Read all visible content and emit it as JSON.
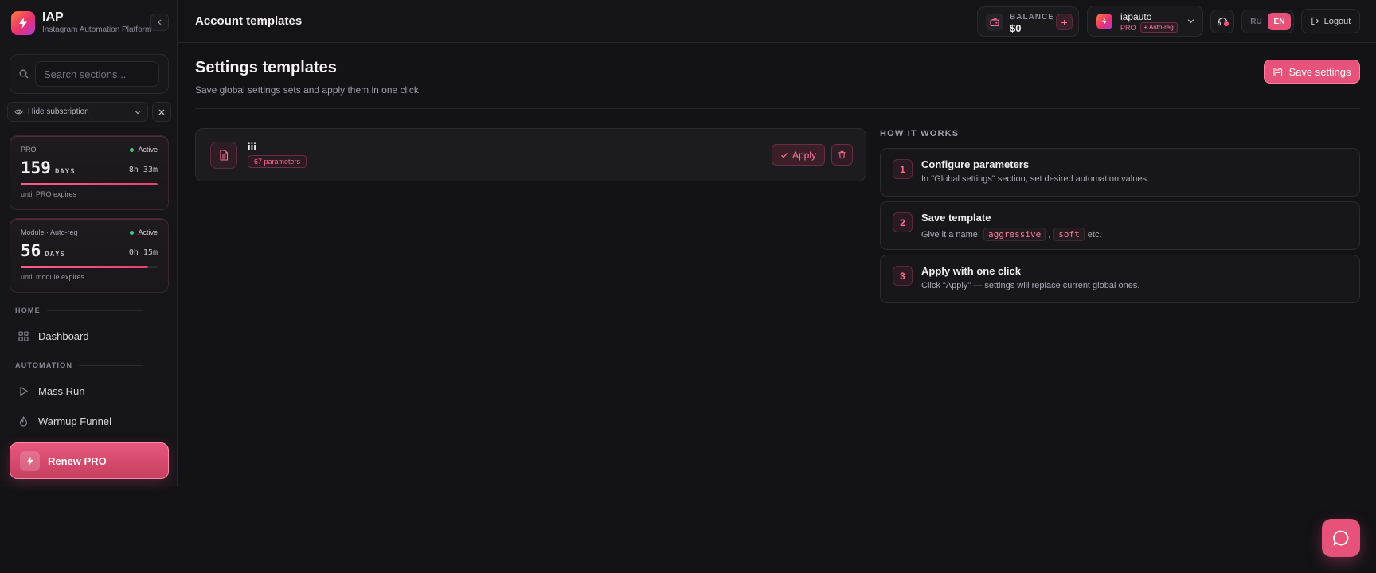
{
  "brand": {
    "title": "IAP",
    "subtitle": "Instagram Automation Platform"
  },
  "sidebar": {
    "search_placeholder": "Search sections...",
    "hide_subscription_label": "Hide subscription",
    "subscriptions": [
      {
        "kind": "PRO",
        "status": "Active",
        "days": "159",
        "days_unit": "DAYS",
        "time": "8h 33m",
        "until": "until PRO expires",
        "progress": 1.0
      },
      {
        "kind": "Module · Auto-reg",
        "status": "Active",
        "days": "56",
        "days_unit": "DAYS",
        "time": "0h 15m",
        "until": "until module expires",
        "progress": 0.93
      }
    ],
    "sections": {
      "home": "HOME",
      "automation": "AUTOMATION"
    },
    "nav": {
      "dashboard": "Dashboard",
      "mass_run": "Mass Run",
      "warmup_funnel": "Warmup Funnel"
    },
    "renew_label": "Renew PRO"
  },
  "topbar": {
    "page": "Account templates",
    "balance_label": "BALANCE",
    "balance_value": "$0",
    "balance_add": "+",
    "account_name": "iapauto",
    "account_plan": "PRO",
    "account_tag": "+ Auto-reg",
    "lang_ru": "RU",
    "lang_en": "EN",
    "logout_label": "Logout"
  },
  "main": {
    "title": "Settings templates",
    "subtitle": "Save global settings sets and apply them in one click",
    "save_label": "Save settings",
    "template": {
      "name": "iii",
      "params": "67 parameters",
      "apply_label": "Apply"
    }
  },
  "how": {
    "title": "HOW IT WORKS",
    "steps": [
      {
        "num": "1",
        "title": "Configure parameters",
        "desc": "In \"Global settings\" section, set desired automation values."
      },
      {
        "num": "2",
        "title": "Save template",
        "desc_prefix": "Give it a name:",
        "code1": "aggressive",
        "sep": ",",
        "code2": "soft",
        "desc_suffix": "etc."
      },
      {
        "num": "3",
        "title": "Apply with one click",
        "desc": "Click \"Apply\" — settings will replace current global ones."
      }
    ]
  },
  "colors": {
    "accent": "#e65279",
    "background": "#131217",
    "success": "#36d17a"
  }
}
